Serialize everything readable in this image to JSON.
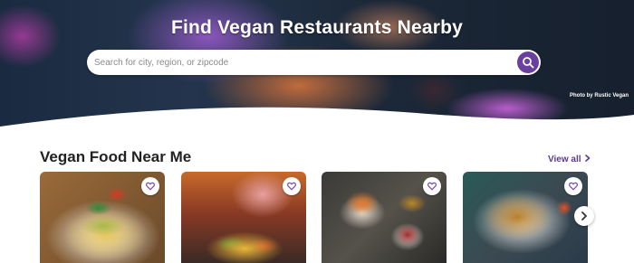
{
  "hero": {
    "title": "Find Vegan Restaurants Nearby",
    "search_placeholder": "Search for city, region, or zipcode",
    "search_icon": "search-icon",
    "photo_credit": "Photo by Rustic Vegan"
  },
  "section": {
    "title": "Vegan Food Near Me",
    "view_all": "View all",
    "view_all_icon": "chevron-right-icon"
  },
  "cards": [
    {
      "image": "nachos-guacamole-photo",
      "favorite_icon": "heart-icon"
    },
    {
      "image": "loaded-nachos-photo",
      "favorite_icon": "heart-icon"
    },
    {
      "image": "tortilla-bowl-salsa-photo",
      "favorite_icon": "heart-icon"
    },
    {
      "image": "fried-tofu-plate-photo",
      "favorite_icon": "heart-icon"
    }
  ],
  "carousel": {
    "next_icon": "chevron-right-icon"
  },
  "colors": {
    "accent": "#6b3fa0",
    "link": "#5a3a8c",
    "heart": "#7a4aa8"
  }
}
